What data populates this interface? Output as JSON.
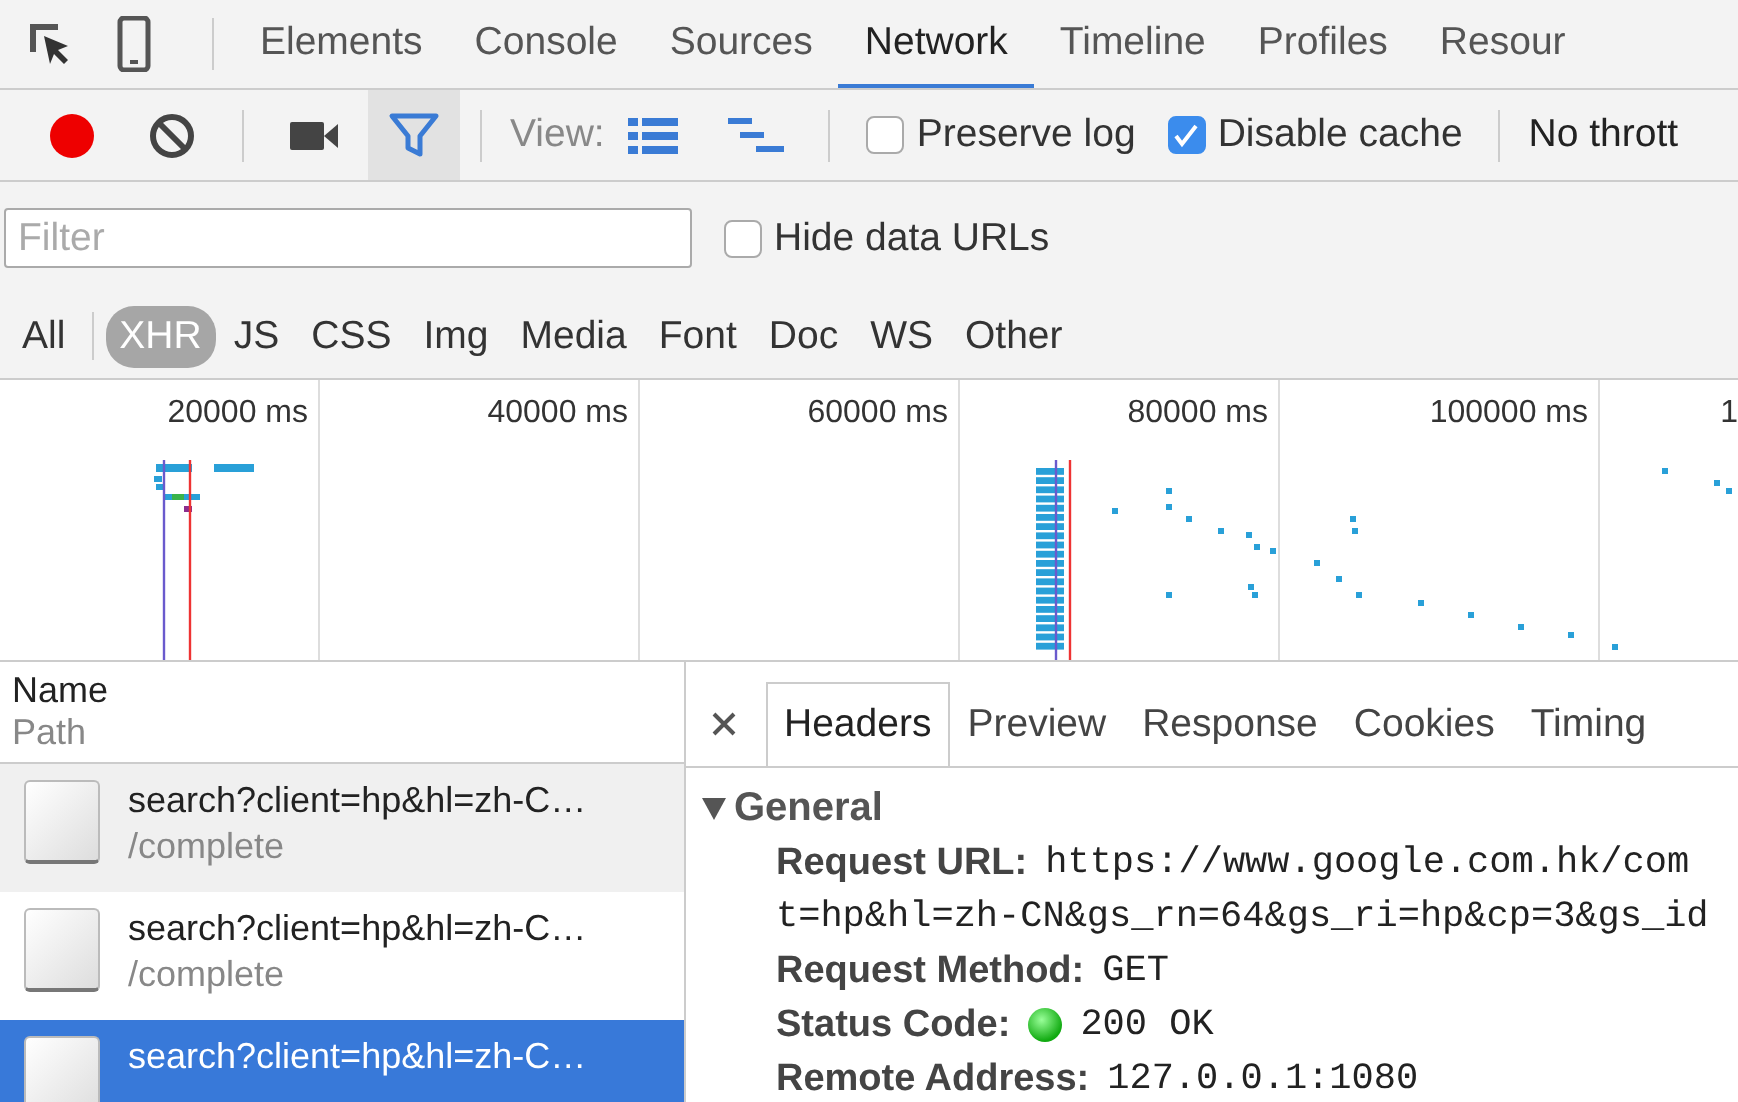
{
  "panel_tabs": [
    {
      "label": "Elements",
      "selected": false
    },
    {
      "label": "Console",
      "selected": false
    },
    {
      "label": "Sources",
      "selected": false
    },
    {
      "label": "Network",
      "selected": true
    },
    {
      "label": "Timeline",
      "selected": false
    },
    {
      "label": "Profiles",
      "selected": false
    },
    {
      "label": "Resour",
      "selected": false
    }
  ],
  "toolbar": {
    "recording": true,
    "filter_on": true,
    "view_label": "View:",
    "preserve_log": {
      "label": "Preserve log",
      "checked": false
    },
    "disable_cache": {
      "label": "Disable cache",
      "checked": true
    },
    "throttling": "No thrott"
  },
  "filter": {
    "placeholder": "Filter"
  },
  "hide_data_urls": {
    "label": "Hide data URLs",
    "checked": false
  },
  "type_filters": [
    {
      "label": "All",
      "selected": false
    },
    {
      "label": "XHR",
      "selected": true
    },
    {
      "label": "JS",
      "selected": false
    },
    {
      "label": "CSS",
      "selected": false
    },
    {
      "label": "Img",
      "selected": false
    },
    {
      "label": "Media",
      "selected": false
    },
    {
      "label": "Font",
      "selected": false
    },
    {
      "label": "Doc",
      "selected": false
    },
    {
      "label": "WS",
      "selected": false
    },
    {
      "label": "Other",
      "selected": false
    }
  ],
  "timeline": {
    "ticks": [
      "20000 ms",
      "40000 ms",
      "60000 ms",
      "80000 ms",
      "100000 ms",
      "1"
    ]
  },
  "requests": {
    "name_header": "Name",
    "path_header": "Path",
    "rows": [
      {
        "name": "search?client=hp&hl=zh-C…",
        "path": "/complete",
        "selected": false
      },
      {
        "name": "search?client=hp&hl=zh-C…",
        "path": "/complete",
        "selected": false
      },
      {
        "name": "search?client=hp&hl=zh-C…",
        "selected": true
      }
    ]
  },
  "details": {
    "tabs": [
      {
        "label": "Headers",
        "selected": true
      },
      {
        "label": "Preview",
        "selected": false
      },
      {
        "label": "Response",
        "selected": false
      },
      {
        "label": "Cookies",
        "selected": false
      },
      {
        "label": "Timing",
        "selected": false
      }
    ],
    "section": {
      "title": "General",
      "expanded": true,
      "fields": [
        {
          "kind": "text",
          "key": "Request URL:",
          "value": "https://www.google.com.hk/com",
          "continuation": "t=hp&hl=zh-CN&gs_rn=64&gs_ri=hp&cp=3&gs_id"
        },
        {
          "kind": "text",
          "key": "Request Method:",
          "value": "GET"
        },
        {
          "kind": "status",
          "key": "Status Code:",
          "value": "200 OK"
        },
        {
          "kind": "text",
          "key": "Remote Address:",
          "value": "127.0.0.1:1080"
        }
      ]
    }
  }
}
